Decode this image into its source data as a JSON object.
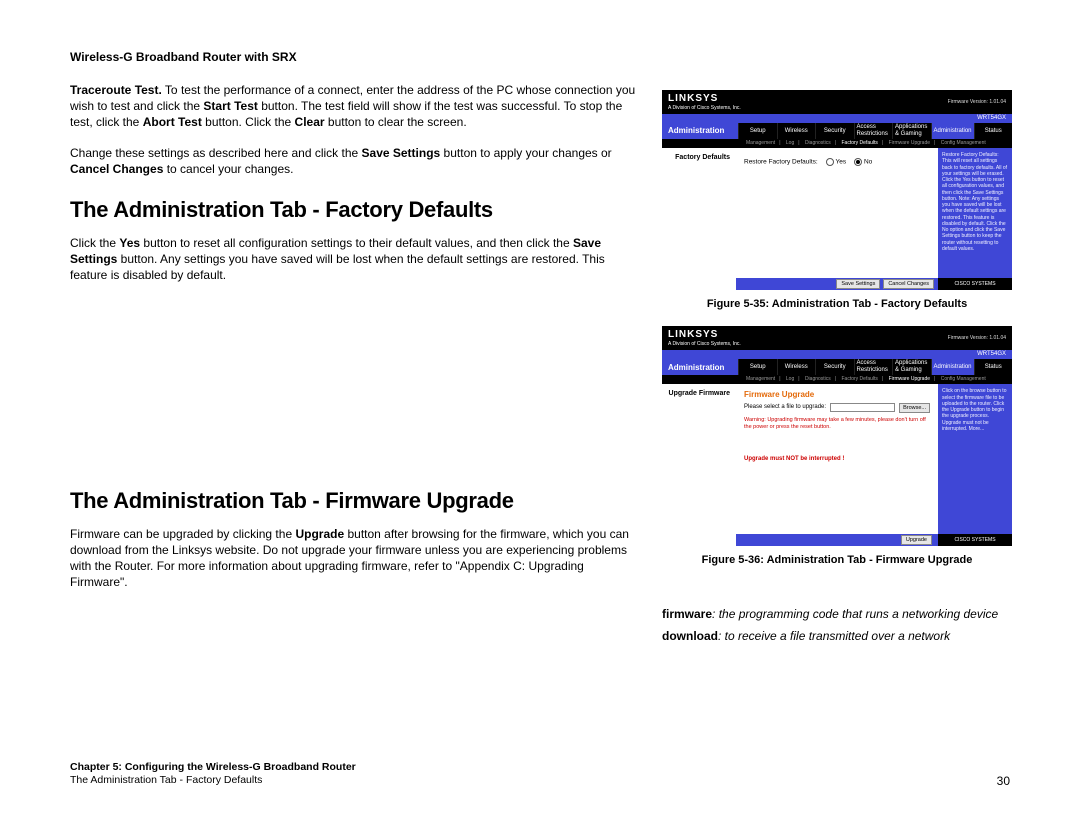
{
  "header": "Wireless-G Broadband Router with SRX",
  "p1_pre": "Traceroute Test.",
  "p1_a": " To test the performance of a connect, enter the address of the PC whose connection you wish to test and click the ",
  "p1_b": "Start Test",
  "p1_c": " button. The test field will show if the test was successful. To stop the test, click the ",
  "p1_d": "Abort Test",
  "p1_e": " button. Click the ",
  "p1_f": "Clear",
  "p1_g": " button to clear the screen.",
  "p2_a": "Change these settings as described here and click the ",
  "p2_b": "Save Settings",
  "p2_c": " button to apply your changes or ",
  "p2_d": "Cancel Changes",
  "p2_e": " to cancel your changes.",
  "h_factory": "The Administration Tab - Factory Defaults",
  "p3_a": "Click the ",
  "p3_b": "Yes",
  "p3_c": " button to reset all configuration settings to their default values, and then click the ",
  "p3_d": "Save Settings",
  "p3_e": " button. Any settings you have saved will be lost when the default settings are restored. This feature is disabled by default.",
  "h_firmware": "The Administration Tab - Firmware Upgrade",
  "p4_a": "Firmware can be upgraded by clicking the ",
  "p4_b": "Upgrade",
  "p4_c": " button after browsing for the firmware, which you can download from the Linksys website. Do not upgrade your firmware unless you are experiencing problems with the Router. For more information about upgrading firmware, refer to \"Appendix C: Upgrading Firmware\".",
  "figcap1": "Figure 5-35: Administration Tab - Factory Defaults",
  "figcap2": "Figure 5-36: Administration Tab - Firmware Upgrade",
  "gloss1_term": "firmware",
  "gloss1_def": ": the programming code that runs a networking device",
  "gloss2_term": "download",
  "gloss2_def": ": to receive a file transmitted over a network",
  "footer_line1": "Chapter 5: Configuring the Wireless-G Broadband Router",
  "footer_line2": "The Administration Tab - Factory Defaults",
  "page_number": "30",
  "shot": {
    "brand": "LINKSYS",
    "brand_sub": "A Division of Cisco Systems, Inc.",
    "fwver1": "Firmware Version: 1.01.04",
    "fwver2": "Firmware Version: 1.01.04",
    "model": "WRT54GX",
    "bigtab": "Administration",
    "tabs": [
      "Setup",
      "Wireless",
      "Security",
      "Access\nRestrictions",
      "Applications\n& Gaming",
      "Administration",
      "Status"
    ],
    "subtabs1": [
      "Management",
      "Log",
      "Diagnostics",
      "Factory Defaults",
      "Firmware Upgrade",
      "Config Management"
    ],
    "subtabs2": [
      "Management",
      "Log",
      "Diagnostics",
      "Factory Defaults",
      "Firmware Upgrade",
      "Config Management"
    ],
    "side1": "Factory Defaults",
    "main1_label": "Restore Factory Defaults:",
    "yes": "Yes",
    "no": "No",
    "help1": "Restore Factory Defaults: This will reset all settings back to factory defaults. All of your settings will be erased. Click the Yes button to reset all configuration values, and then click the Save Settings button. Note: Any settings you have saved will be lost when the default settings are restored. This feature is disabled by default. Click the No option and click the Save Settings button to keep the router without resetting to default values.",
    "save": "Save Settings",
    "cancel": "Cancel Changes",
    "cisco": "CISCO SYSTEMS",
    "side2": "Upgrade Firmware",
    "fw_title": "Firmware Upgrade",
    "fw_label": "Please select a file to upgrade:",
    "fw_browse": "Browse...",
    "fw_warn": "Warning: Upgrading firmware may take a few minutes, please don't turn off the power or press the reset button.",
    "fw_boldwarn": "Upgrade must NOT be interrupted !",
    "help2": "Click on the browse button to select the firmware file to be uploaded to the router.\n\nClick the Upgrade button to begin the upgrade process. Upgrade must not be interrupted. More...",
    "upgrade": "Upgrade"
  }
}
